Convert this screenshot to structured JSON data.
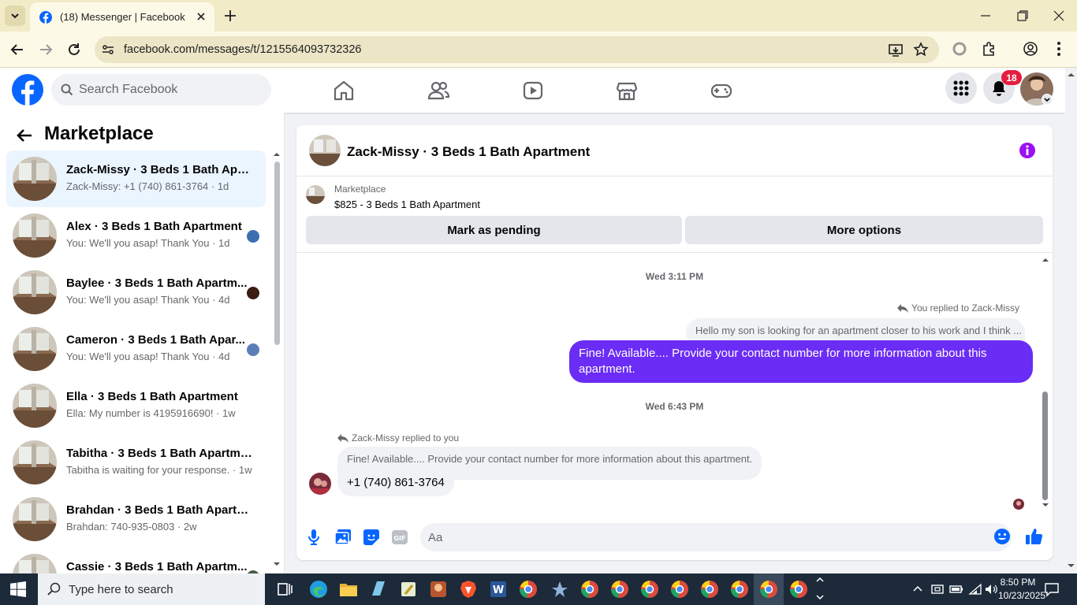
{
  "browser": {
    "tab_title": "(18) Messenger | Facebook",
    "url": "facebook.com/messages/t/1215564093732326"
  },
  "facebook": {
    "search_placeholder": "Search Facebook",
    "notification_count": "18"
  },
  "left_panel": {
    "title": "Marketplace",
    "conversations": [
      {
        "name": "Zack-Missy · 3 Beds 1 Bath Apart...",
        "preview": "Zack-Missy: +1 (740) 861-3764 · 1d",
        "active": true
      },
      {
        "name": "Alex · 3 Beds 1 Bath Apartment",
        "preview": "You: We'll you asap! Thank You · 1d"
      },
      {
        "name": "Baylee · 3 Beds 1 Bath Apartm...",
        "preview": "You: We'll you asap! Thank You · 4d"
      },
      {
        "name": "Cameron · 3 Beds 1 Bath Apar...",
        "preview": "You: We'll you asap! Thank You · 4d"
      },
      {
        "name": "Ella · 3 Beds 1 Bath Apartment",
        "preview": "Ella: My number is 4195916690! · 1w"
      },
      {
        "name": "Tabitha · 3 Beds 1 Bath Apartment",
        "preview": "Tabitha is waiting for your response. · 1w"
      },
      {
        "name": "Brahdan · 3 Beds 1 Bath Apartm...",
        "preview": "Brahdan: 740-935-0803 · 2w"
      },
      {
        "name": "Cassie · 3 Beds 1 Bath Apartm...",
        "preview": ""
      }
    ]
  },
  "chat": {
    "title": "Zack-Missy · 3 Beds 1 Bath Apartment",
    "listing_kicker": "Marketplace",
    "listing_title": "$825 - 3 Beds 1 Bath Apartment",
    "mark_pending_label": "Mark as pending",
    "more_options_label": "More options",
    "timestamp_1": "Wed 3:11 PM",
    "outgoing_reply_note": "You replied to Zack-Missy",
    "outgoing_quote": "Hello my son is looking for an apartment closer to his work and I think ...",
    "outgoing_message": "Fine! Available.... Provide your contact number for more information about this apartment.",
    "timestamp_2": "Wed 6:43 PM",
    "incoming_reply_note": "Zack-Missy replied to you",
    "incoming_quote": "Fine! Available.... Provide your contact number for more information about this apartment.",
    "incoming_message": "+1 (740) 861-3764",
    "composer_placeholder": "Aa"
  },
  "taskbar": {
    "search_text": "Type here to search",
    "time": "8:50 PM",
    "date": "10/23/2025"
  },
  "colors": {
    "facebook_blue": "#0866ff",
    "messenger_purple": "#6b2cf5",
    "notification_red": "#e41e3f",
    "active_conversation": "#ebf5ff"
  }
}
